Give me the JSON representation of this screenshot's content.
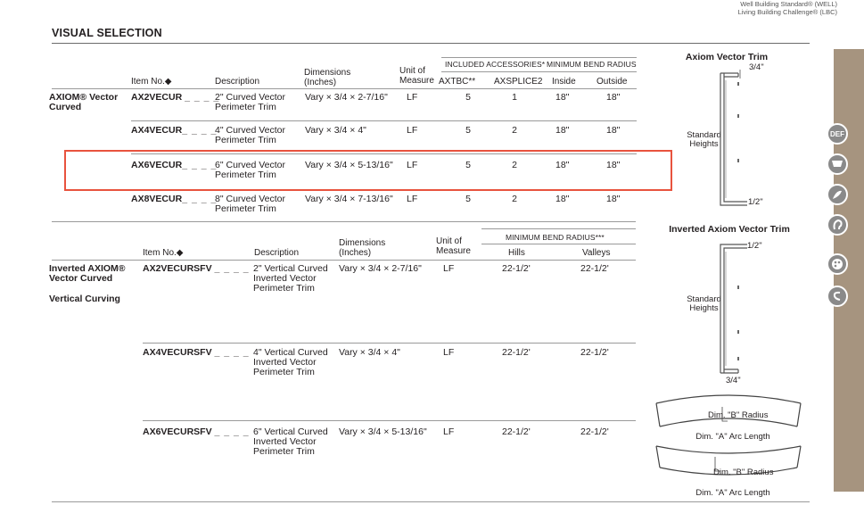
{
  "header": {
    "standards_line1": "Well Building Standard® (WELL)",
    "standards_line2": "Living Building Challenge® (LBC)"
  },
  "section_title": "VISUAL SELECTION",
  "table1": {
    "headers": {
      "item_no": "Item No.◆",
      "description": "Description",
      "dimensions": "Dimensions (Inches)",
      "unit": "Unit of Measure",
      "included_accessories": "INCLUDED ACCESSORIES*",
      "axtbc": "AXTBC**",
      "axsplice2": "AXSPLICE2",
      "min_bend_radius": "MINIMUM BEND RADIUS",
      "inside": "Inside",
      "outside": "Outside"
    },
    "group_name": "AXIOM® Vector Curved",
    "rows": [
      {
        "item": "AX2VECUR",
        "blank": "_ _ _ _",
        "desc": "2\" Curved Vector Perimeter Trim",
        "dim": "Vary × 3/4 × 2-7/16\"",
        "unit": "LF",
        "axtbc": "5",
        "axsplice2": "1",
        "inside": "18\"",
        "outside": "18\""
      },
      {
        "item": "AX4VECUR",
        "blank": "_ _ _ _",
        "desc": "4\" Curved Vector Perimeter Trim",
        "dim": "Vary × 3/4 × 4\"",
        "unit": "LF",
        "axtbc": "5",
        "axsplice2": "2",
        "inside": "18\"",
        "outside": "18\""
      },
      {
        "item": "AX6VECUR",
        "blank": "_ _ _ _",
        "desc": "6\" Curved Vector Perimeter Trim",
        "dim": "Vary × 3/4 × 5-13/16\"",
        "unit": "LF",
        "axtbc": "5",
        "axsplice2": "2",
        "inside": "18\"",
        "outside": "18\""
      },
      {
        "item": "AX8VECUR",
        "blank": "_ _ _ _",
        "desc": "8\" Curved Vector Perimeter Trim",
        "dim": "Vary × 3/4 × 7-13/16\"",
        "unit": "LF",
        "axtbc": "5",
        "axsplice2": "2",
        "inside": "18\"",
        "outside": "18\""
      }
    ]
  },
  "table2": {
    "headers": {
      "item_no": "Item No.◆",
      "description": "Description",
      "dimensions": "Dimensions (Inches)",
      "unit": "Unit of Measure",
      "min_bend_radius": "MINIMUM BEND RADIUS***",
      "hills": "Hills",
      "valleys": "Valleys"
    },
    "group_name": "Inverted AXIOM® Vector Curved",
    "group_sub": "Vertical Curving",
    "rows": [
      {
        "item": "AX2VECURSFV",
        "blank": "_ _ _ _",
        "desc": "2\" Vertical Curved Inverted Vector Perimeter Trim",
        "dim": "Vary × 3/4 × 2-7/16\"",
        "unit": "LF",
        "hills": "22-1/2'",
        "valleys": "22-1/2'"
      },
      {
        "item": "AX4VECURSFV",
        "blank": "_ _ _ _",
        "desc": "4\" Vertical Curved Inverted Vector Perimeter Trim",
        "dim": "Vary × 3/4 × 4\"",
        "unit": "LF",
        "hills": "22-1/2'",
        "valleys": "22-1/2'"
      },
      {
        "item": "AX6VECURSFV",
        "blank": "_ _ _ _",
        "desc": "6\" Vertical Curved Inverted Vector Perimeter Trim",
        "dim": "Vary × 3/4 × 5-13/16\"",
        "unit": "LF",
        "hills": "22-1/2'",
        "valleys": "22-1/2'"
      }
    ]
  },
  "diagrams": {
    "axiom_title": "Axiom Vector Trim",
    "axiom_top": "3/4\"",
    "axiom_side": "Standard Heights",
    "axiom_bottom": "1/2\"",
    "inverted_title": "Inverted Axiom Vector Trim",
    "inverted_top": "1/2\"",
    "inverted_side": "Standard Heights",
    "inverted_bottom": "3/4\"",
    "arc1_b": "Dim. \"B\" Radius",
    "arc1_a": "Dim. \"A\" Arc Length",
    "arc2_b": "Dim. \"B\" Radius",
    "arc2_a": "Dim. \"A\" Arc Length"
  },
  "sidebar_icons": [
    "def-icon",
    "ceiling-icon",
    "hand-leaf-icon",
    "ear-icon",
    "palette-icon",
    "swirl-icon"
  ],
  "sidebar_icon_labels": {
    "def": "DEF"
  },
  "colors": {
    "highlight": "#e8533e",
    "sidebar": "#a6947f",
    "icon": "#8a8a8a"
  }
}
